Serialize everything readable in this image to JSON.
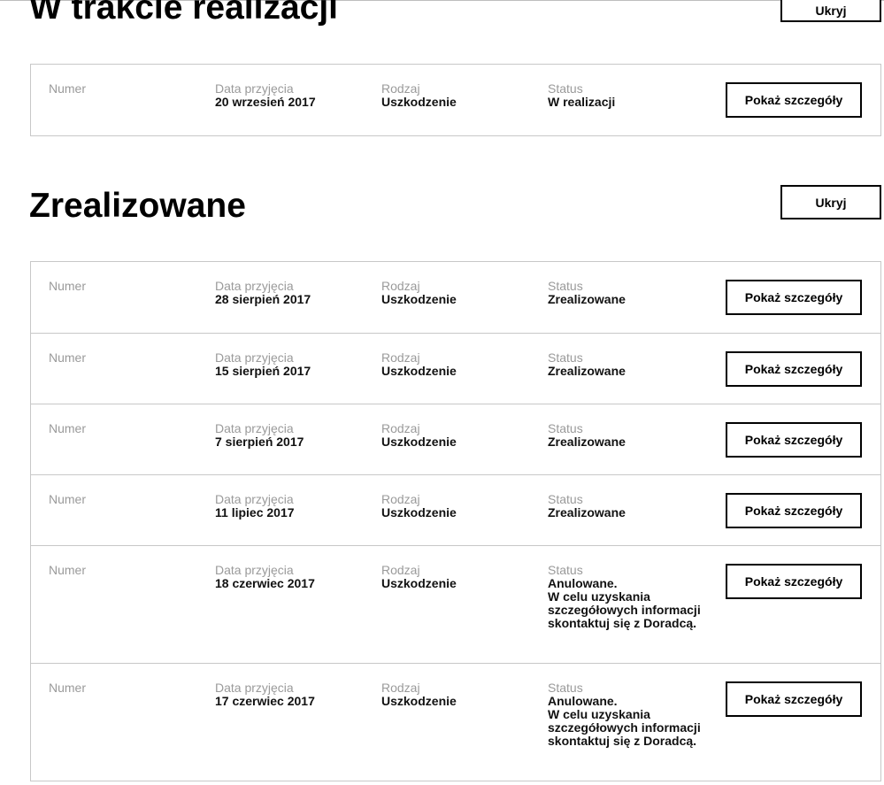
{
  "sections": [
    {
      "title": "W trakcie realizacji",
      "hide_label": "Ukryj",
      "orders": [
        {
          "number_label": "Numer",
          "date_label": "Data przyjęcia",
          "date": "20 wrzesień 2017",
          "type_label": "Rodzaj",
          "type": "Uszkodzenie",
          "status_label": "Status",
          "status": "W realizacji",
          "button_label": "Pokaż szczegóły"
        }
      ]
    },
    {
      "title": "Zrealizowane",
      "hide_label": "Ukryj",
      "orders": [
        {
          "number_label": "Numer",
          "date_label": "Data przyjęcia",
          "date": "28 sierpień 2017",
          "type_label": "Rodzaj",
          "type": "Uszkodzenie",
          "status_label": "Status",
          "status": "Zrealizowane",
          "button_label": "Pokaż szczegóły"
        },
        {
          "number_label": "Numer",
          "date_label": "Data przyjęcia",
          "date": "15 sierpień 2017",
          "type_label": "Rodzaj",
          "type": "Uszkodzenie",
          "status_label": "Status",
          "status": "Zrealizowane",
          "button_label": "Pokaż szczegóły"
        },
        {
          "number_label": "Numer",
          "date_label": "Data przyjęcia",
          "date": "7 sierpień 2017",
          "type_label": "Rodzaj",
          "type": "Uszkodzenie",
          "status_label": "Status",
          "status": "Zrealizowane",
          "button_label": "Pokaż szczegóły"
        },
        {
          "number_label": "Numer",
          "date_label": "Data przyjęcia",
          "date": "11 lipiec 2017",
          "type_label": "Rodzaj",
          "type": "Uszkodzenie",
          "status_label": "Status",
          "status": "Zrealizowane",
          "button_label": "Pokaż szczegóły"
        },
        {
          "number_label": "Numer",
          "date_label": "Data przyjęcia",
          "date": "18 czerwiec 2017",
          "type_label": "Rodzaj",
          "type": "Uszkodzenie",
          "status_label": "Status",
          "status": "Anulowane.\nW celu uzyskania szczegółowych informacji skontaktuj się z Doradcą.",
          "button_label": "Pokaż szczegóły"
        },
        {
          "number_label": "Numer",
          "date_label": "Data przyjęcia",
          "date": "17 czerwiec 2017",
          "type_label": "Rodzaj",
          "type": "Uszkodzenie",
          "status_label": "Status",
          "status": "Anulowane.\nW celu uzyskania szczegółowych informacji skontaktuj się z Doradcą.",
          "button_label": "Pokaż szczegóły"
        }
      ]
    }
  ]
}
